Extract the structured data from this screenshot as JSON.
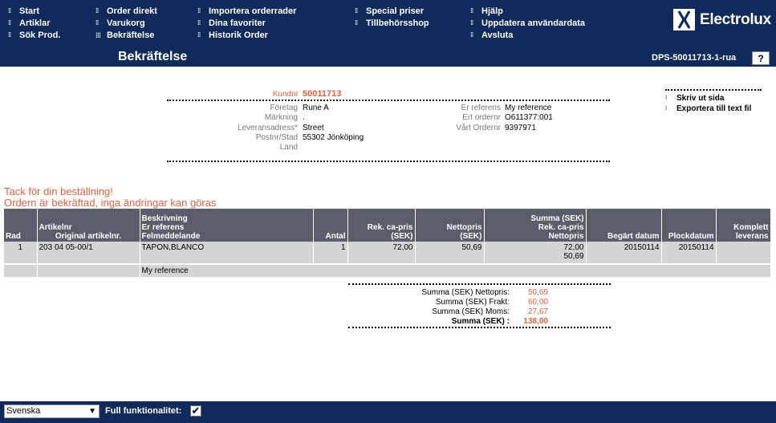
{
  "nav": {
    "col1": [
      "Start",
      "Artiklar",
      "Sök Prod."
    ],
    "col2": [
      "Order direkt",
      "Varukorg",
      "Bekräftelse"
    ],
    "col3": [
      "Importera orderrader",
      "Dina favoriter",
      "Historik Order"
    ],
    "col4": [
      "Special priser",
      "Tillbehörsshop"
    ],
    "col5": [
      "Hjälp",
      "Uppdatera användardata",
      "Avsluta"
    ]
  },
  "brand": {
    "name": "Electrolux",
    "color": "#102a5c",
    "accent": "#e06040"
  },
  "header": {
    "title": "Bekräftelse",
    "doc_id": "DPS-50011713-1-rua",
    "help": "?"
  },
  "customer": {
    "kundnr_label": "Kundnr",
    "kundnr": "50011713",
    "fields_left": [
      {
        "label": "Företag",
        "value": "Rune A"
      },
      {
        "label": "Märkning",
        "value": "."
      },
      {
        "label": "Leveransadress*",
        "value": "Street"
      },
      {
        "label": "Postnr/Stad",
        "value": "55302 Jönköping"
      },
      {
        "label": "Land",
        "value": ""
      }
    ],
    "fields_right": [
      {
        "label": "Er referens",
        "value": "My reference"
      },
      {
        "label": "Ert ordernr",
        "value": "O611377:001"
      },
      {
        "label": "Vårt Ordernr",
        "value": "9397971"
      }
    ]
  },
  "actions": {
    "print": "Skriv ut sida",
    "export": "Exportera till text fil"
  },
  "messages": {
    "thanks": "Tack för din beställning!",
    "confirmed": "Ordern är bekräftad, inga ändringar kan göras"
  },
  "table": {
    "headers": {
      "rad": "Rad",
      "artikelnr": "Artikelnr",
      "orig_artikelnr": "Original artikelnr.",
      "beskrivning": "Beskrivning",
      "er_referens": "Er referens",
      "felmeddelande": "Felmeddelande",
      "antal": "Antal",
      "rek_ca_pris": "Rek. ca-pris",
      "rek_unit": "(SEK)",
      "nettopris": "Nettopris",
      "netto_unit": "(SEK)",
      "summa_head": "Summa  (SEK)",
      "summa_rek": "Rek. ca-pris",
      "summa_netto": "Nettopris",
      "begart_datum": "Begärt datum",
      "plockdatum": "Plockdatum",
      "komplett": "Komplett",
      "leverans": "leverans"
    },
    "rows": [
      {
        "rad": "1",
        "artikelnr": "203 04 05-00/1",
        "beskrivning": "TAPON,BLANCO",
        "antal": "1",
        "rek_ca_pris": "72,00",
        "nettopris": "50,69",
        "summa_rek": "72,00",
        "summa_netto": "50,69",
        "begart_datum": "20150114",
        "plockdatum": "20150114",
        "komplett": "",
        "referens": "My reference"
      }
    ]
  },
  "summary": {
    "rows": [
      {
        "label": "Summa  (SEK) Nettopris:",
        "value": "50,69"
      },
      {
        "label": "Summa  (SEK) Frakt:",
        "value": "60,00"
      },
      {
        "label": "Summa  (SEK) Moms:",
        "value": "27,67"
      },
      {
        "label": "Summa  (SEK) :",
        "value": "138,00"
      }
    ]
  },
  "footer": {
    "language": "Svenska",
    "full_label": "Full funktionalitet:",
    "full_checked": "✔"
  }
}
